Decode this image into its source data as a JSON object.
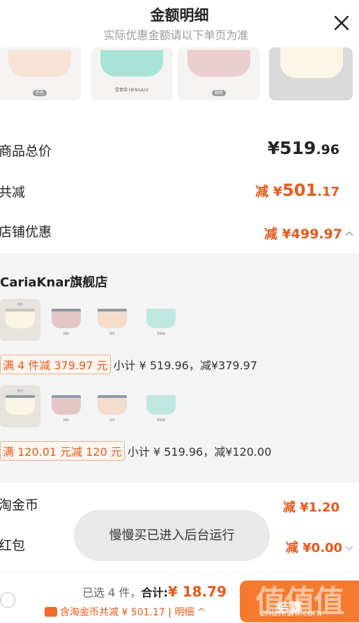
{
  "header": {
    "title": "金额明细",
    "subtitle": "实际优惠金额请以下单页为准"
  },
  "product_strip": {
    "items": [
      {
        "tag": "杏色",
        "color": "#f6e3d6"
      },
      {
        "tag": "雪青绿 HENGALV",
        "color": "#a9e3d8"
      },
      {
        "tag": "桃粉",
        "color": "#e9cdcf"
      },
      {
        "tag": "",
        "color": "#fbf7e6"
      }
    ]
  },
  "summary": {
    "total_label": "商品总价",
    "total_currency": "¥",
    "total_int": "519",
    "total_dec": ".96",
    "reduce_label": "共减",
    "reduce_prefix": "减 ¥",
    "reduce_int": "501",
    "reduce_dec": ".17",
    "shop_label": "店铺优惠",
    "shop_value": "减 ¥499.97"
  },
  "store": {
    "name_latin": "CariaKnar",
    "name_cn": "旗舰店",
    "groups": [
      {
        "thumbs": [
          {
            "tag": "杏白",
            "color": "#faf6e4",
            "band": "#c8c4bb"
          },
          {
            "tag": "桃粉",
            "color": "#e3c7c6",
            "band": "#8e9aa8"
          },
          {
            "tag": "杏色",
            "color": "#f4dccb",
            "band": "#8e9aa8"
          },
          {
            "tag": "雪青绿",
            "color": "#bfe7df",
            "band": "#bfe7df"
          }
        ],
        "badge": "满 4 件减 379.97 元",
        "subtotal": "小计 ¥ 519.96，减¥379.97"
      },
      {
        "thumbs": [
          {
            "tag": "杏白",
            "color": "#faf6e4",
            "band": "#8e9aa8"
          },
          {
            "tag": "桃粉",
            "color": "#e3c7c6",
            "band": "#8e9aa8"
          },
          {
            "tag": "杏色",
            "color": "#f4dccb",
            "band": "#8e9aa8"
          },
          {
            "tag": "雪青绿",
            "color": "#bfe7df",
            "band": "#bfe7df"
          }
        ],
        "badge": "满 120.01 元减 120 元",
        "subtotal": "小计 ¥ 519.96，减¥120.00"
      }
    ]
  },
  "lower": {
    "coin_label": "淘金币",
    "coin_value": "减 ¥1.20",
    "redpack_label": "红包",
    "redpack_value": "减 ¥0.00"
  },
  "toast": {
    "text": "慢慢买已进入后台运行"
  },
  "bottom_bar": {
    "selected_text": "已选 4 件，",
    "total_label": "合计:",
    "total_value": "¥ 18.79",
    "detail_text": "含淘金币共减 ¥ 501.17 | 明细 ^",
    "checkout_label": "结算"
  },
  "watermark": {
    "logo": "值值值",
    "url": "zhizhizhi.com"
  },
  "colors": {
    "accent": "#e8591a",
    "checkout": "#f47a2e",
    "panel_bg": "#f4f4f4"
  }
}
